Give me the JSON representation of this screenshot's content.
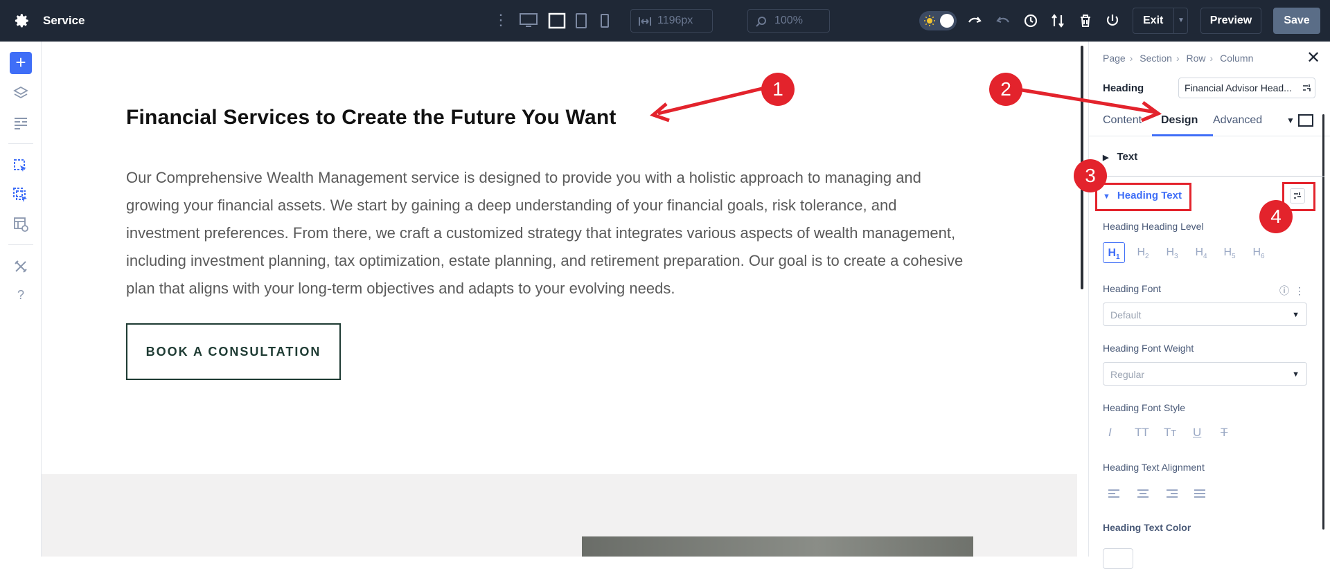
{
  "topbar": {
    "title": "Service",
    "width_value": "1196px",
    "zoom_value": "100%",
    "exit_label": "Exit",
    "preview_label": "Preview",
    "save_label": "Save"
  },
  "canvas": {
    "heading": "Financial Services to Create the Future You Want",
    "body": "Our Comprehensive Wealth Management service is designed to provide you with a holistic approach to managing and growing your financial assets. We start by gaining a deep understanding of your financial goals, risk tolerance, and investment preferences. From there, we craft a customized strategy that integrates various aspects of wealth management, including investment planning, tax optimization, estate planning, and retirement preparation. Our goal is to create a cohesive plan that aligns with your long-term objectives and adapts to your evolving needs.",
    "cta_label": "BOOK A CONSULTATION"
  },
  "panel": {
    "breadcrumb": [
      "Page",
      "Section",
      "Row",
      "Column"
    ],
    "module_label": "Heading",
    "module_name": "Financial Advisor Head...",
    "tabs": [
      "Content",
      "Design",
      "Advanced"
    ],
    "active_tab": "Design",
    "section_text": "Text",
    "section_heading_text": "Heading Text",
    "heading_level_label": "Heading Heading Level",
    "heading_levels": [
      "H1",
      "H2",
      "H3",
      "H4",
      "H5",
      "H6"
    ],
    "heading_font_label": "Heading Font",
    "heading_font_value": "Default",
    "heading_font_weight_label": "Heading Font Weight",
    "heading_font_weight_value": "Regular",
    "heading_font_style_label": "Heading Font Style",
    "heading_font_styles": [
      "I",
      "TT",
      "Tт",
      "U",
      "T"
    ],
    "heading_alignment_label": "Heading Text Alignment",
    "heading_color_label": "Heading Text Color"
  },
  "annotations": [
    "1",
    "2",
    "3",
    "4"
  ],
  "colors": {
    "annotation_red": "#e3232c",
    "accent_blue": "#3f6ef7",
    "topbar_bg": "#1f2836",
    "cta_border": "#1e3b33"
  },
  "icons": [
    "gear-icon",
    "kebab-icon",
    "desktop-icon",
    "wireframe-icon",
    "tablet-icon",
    "phone-icon",
    "width-icon",
    "zoom-icon",
    "sun-icon",
    "undo-icon",
    "redo-icon",
    "history-icon",
    "sort-icon",
    "trash-icon",
    "power-icon",
    "layers-icon",
    "layout-icon",
    "click-icon",
    "click-multi-icon",
    "template-icon",
    "tools-icon",
    "help-icon",
    "close-icon",
    "info-icon",
    "more-icon",
    "dynamic-content-icon"
  ]
}
